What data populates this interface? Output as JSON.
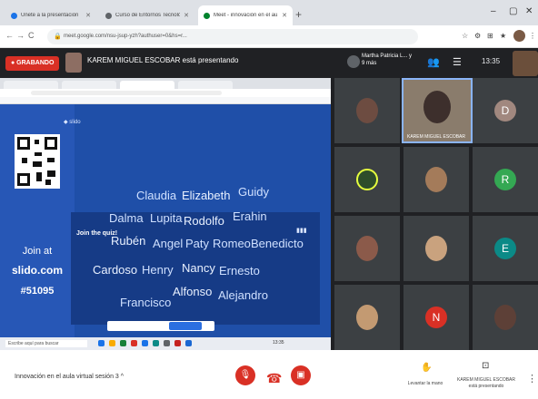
{
  "browser": {
    "tabs": [
      {
        "label": "Unete a la presentación",
        "favicon_color": "#1a73e8"
      },
      {
        "label": "Curso de Entornos Tecnológicos",
        "favicon_color": "#5f6368"
      },
      {
        "label": "Meet - innovación en el au...",
        "favicon_color": "#00832d",
        "active": true
      }
    ],
    "new_tab": "+",
    "window_controls": {
      "min": "–",
      "max": "▢",
      "close": "✕"
    },
    "url": "meet.google.com/nsu-jsup-yzh?authuser=0&hs=r...",
    "nav": {
      "back": "←",
      "forward": "→",
      "reload": "C",
      "home": "⌂"
    },
    "extensions": [
      "☆",
      "⚙",
      "⊞",
      "★",
      "⋮"
    ]
  },
  "meet_top": {
    "recording_label": "● GRABANDO",
    "presenter_title": "KAREM MIGUEL ESCOBAR está presentando",
    "participant_label": "Martha Patricia L... y 9 más",
    "icons": [
      "people-icon",
      "chat-icon"
    ],
    "time": "13:35"
  },
  "shared_screen": {
    "join_at": "Join at",
    "site": "slido.com",
    "code": "#51095",
    "join_quiz": "Join the quiz!",
    "names": [
      {
        "text": "Claudia",
        "emph": false
      },
      {
        "text": "Elizabeth",
        "emph": true
      },
      {
        "text": "Guidy",
        "emph": false
      },
      {
        "text": "Dalma",
        "emph": false
      },
      {
        "text": "Lupita",
        "emph": false
      },
      {
        "text": "Rodolfo",
        "emph": true
      },
      {
        "text": "Erahin",
        "emph": false
      },
      {
        "text": "Rubén",
        "emph": true
      },
      {
        "text": "Angel",
        "emph": false
      },
      {
        "text": "Paty",
        "emph": false
      },
      {
        "text": "Romeo",
        "emph": false
      },
      {
        "text": "Benedicto",
        "emph": false
      },
      {
        "text": "Cardoso",
        "emph": true
      },
      {
        "text": "Henry",
        "emph": false
      },
      {
        "text": "Nancy",
        "emph": true
      },
      {
        "text": "Ernesto",
        "emph": false
      },
      {
        "text": "Francisco",
        "emph": false
      },
      {
        "text": "Alfonso",
        "emph": true
      },
      {
        "text": "Alejandro",
        "emph": false
      }
    ],
    "taskbar_search": "Escribe aquí para buscar",
    "taskbar_time": "13:35"
  },
  "participants": {
    "speaker_caption": "KAREM MIGUEL ESCOBAR",
    "letters": {
      "d": "D",
      "r": "R",
      "e": "E",
      "n": "N"
    },
    "colors": {
      "d": "#a1887f",
      "r": "#34a853",
      "e": "#0b8a87",
      "n": "#d93025"
    }
  },
  "bottom_bar": {
    "meeting_name": "Innovación en el aula virtual sesión 3  ^",
    "mic_icon": "🎙",
    "hangup_icon": "☎",
    "cam_icon": "▣",
    "raise_hand": "Levantar la mano",
    "presenter_label": "KAREM MIGUEL ESCOBAR está presentando",
    "more": "⋮"
  }
}
